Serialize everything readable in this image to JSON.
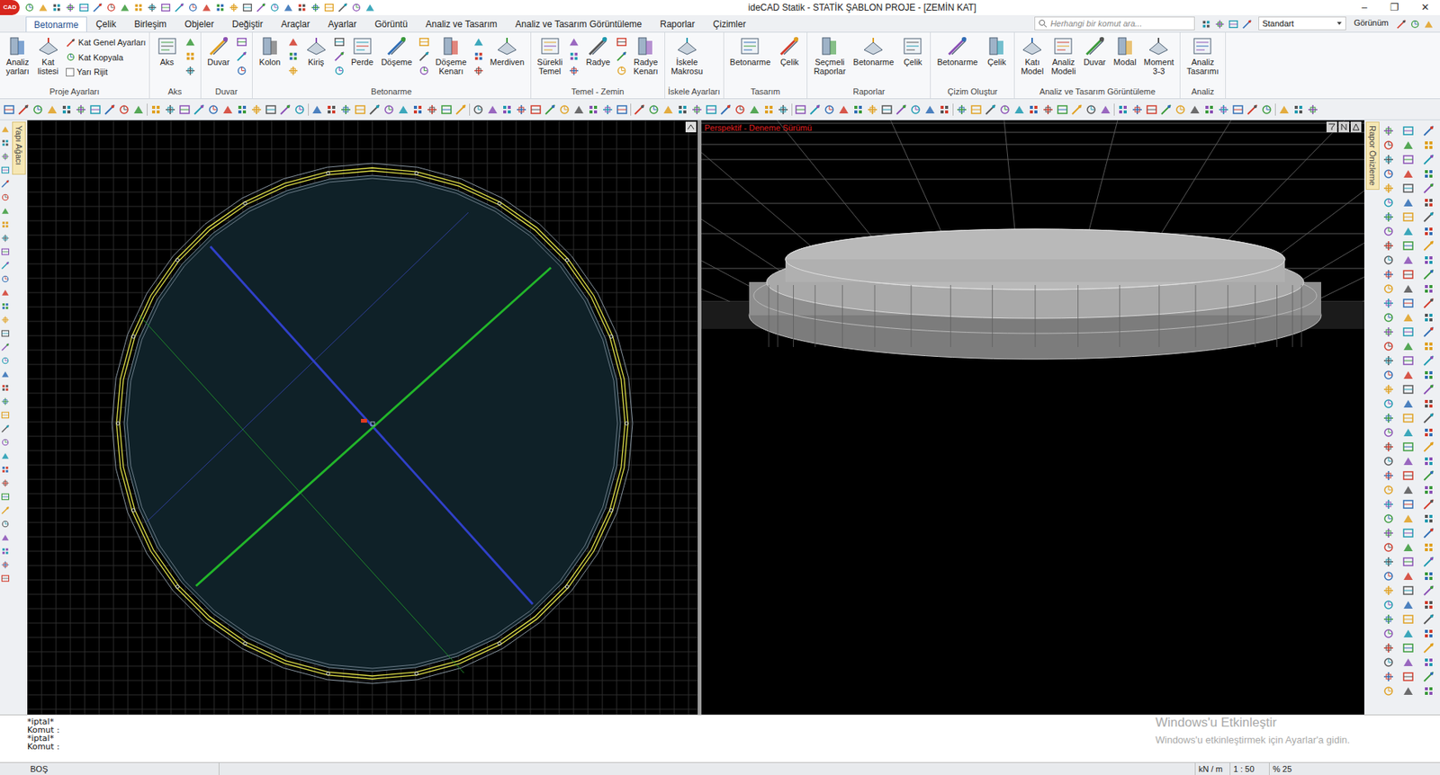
{
  "window": {
    "logo": "CAD",
    "title": "ideCAD Statik - STATİK ŞABLON PROJE - [ZEMİN KAT]",
    "controls": [
      "–",
      "❐",
      "✕"
    ]
  },
  "tabs": [
    {
      "label": "Betonarme",
      "selected": true
    },
    {
      "label": "Çelik",
      "selected": false
    },
    {
      "label": "Birleşim",
      "selected": false
    },
    {
      "label": "Objeler",
      "selected": false
    },
    {
      "label": "Değiştir",
      "selected": false
    },
    {
      "label": "Araçlar",
      "selected": false
    },
    {
      "label": "Ayarlar",
      "selected": false
    },
    {
      "label": "Görüntü",
      "selected": false
    },
    {
      "label": "Analiz ve Tasarım",
      "selected": false
    },
    {
      "label": "Analiz ve Tasarım Görüntüleme",
      "selected": false
    },
    {
      "label": "Raporlar",
      "selected": false
    },
    {
      "label": "Çizimler",
      "selected": false
    }
  ],
  "search": {
    "placeholder": "Herhangi bir komut ara..."
  },
  "style_select": "Standart",
  "view_menu": "Görünüm",
  "ribbon": {
    "groups": [
      {
        "label": "Proje Ayarları",
        "buttons": [
          {
            "lines": [
              "Analiz",
              "yarları"
            ]
          },
          {
            "lines": [
              "Kat",
              "listesi"
            ]
          }
        ],
        "small": [
          {
            "label": "Kat Genel Ayarları",
            "kind": "link"
          },
          {
            "label": "Kat Kopyala",
            "kind": "link"
          },
          {
            "label": "Yarı Rijit",
            "kind": "checkbox",
            "checked": false
          }
        ]
      },
      {
        "label": "Aks",
        "buttons": [
          {
            "lines": [
              "Aks"
            ]
          }
        ]
      },
      {
        "label": "Duvar",
        "buttons": [
          {
            "lines": [
              "Duvar"
            ]
          }
        ]
      },
      {
        "label": "Betonarme",
        "buttons": [
          {
            "lines": [
              "Kolon"
            ]
          },
          {
            "lines": [
              "Kiriş"
            ]
          },
          {
            "lines": [
              "Perde"
            ]
          },
          {
            "lines": [
              "Döşeme"
            ]
          },
          {
            "lines": [
              "Döşeme",
              "Kenarı"
            ]
          },
          {
            "lines": [
              "Merdiven"
            ]
          }
        ]
      },
      {
        "label": "Temel - Zemin",
        "buttons": [
          {
            "lines": [
              "Sürekli",
              "Temel"
            ]
          },
          {
            "lines": [
              "Radye"
            ]
          },
          {
            "lines": [
              "Radye",
              "Kenarı"
            ]
          }
        ]
      },
      {
        "label": "İskele Ayarları",
        "buttons": [
          {
            "lines": [
              "İskele",
              "Makrosu"
            ]
          }
        ]
      },
      {
        "label": "Tasarım",
        "buttons": [
          {
            "lines": [
              "Betonarme"
            ]
          },
          {
            "lines": [
              "Çelik"
            ]
          }
        ]
      },
      {
        "label": "Raporlar",
        "buttons": [
          {
            "lines": [
              "Seçmeli",
              "Raporlar"
            ]
          },
          {
            "lines": [
              "Betonarme"
            ]
          },
          {
            "lines": [
              "Çelik"
            ]
          }
        ]
      },
      {
        "label": "Çizim Oluştur",
        "buttons": [
          {
            "lines": [
              "Betonarme"
            ]
          },
          {
            "lines": [
              "Çelik"
            ]
          }
        ]
      },
      {
        "label": "Analiz ve Tasarım Görüntüleme",
        "buttons": [
          {
            "lines": [
              "Katı",
              "Model"
            ]
          },
          {
            "lines": [
              "Analiz",
              "Modeli"
            ]
          },
          {
            "lines": [
              "Duvar"
            ]
          },
          {
            "lines": [
              "Modal"
            ]
          },
          {
            "lines": [
              "Moment",
              "3-3"
            ]
          }
        ]
      },
      {
        "label": "Analiz",
        "buttons": [
          {
            "lines": [
              "Analiz",
              "Tasarımı"
            ]
          }
        ]
      }
    ]
  },
  "side_tabs": {
    "left": "Yapı Ağacı",
    "right": "Rapor Önizleme"
  },
  "perspective_label": "Perspektif - Deneme Sürümü",
  "command_lines": [
    "*iptal*",
    "Komut :",
    "*iptal*",
    "Komut :"
  ],
  "status_bar": {
    "left": "BOŞ",
    "units": "kN / m",
    "scale": "1 : 50",
    "zoom": "% 25"
  },
  "watermark": {
    "title": "Windows'u Etkinleştir",
    "subtitle": "Windows'u etkinleştirmek için Ayarlar'a gidin."
  }
}
